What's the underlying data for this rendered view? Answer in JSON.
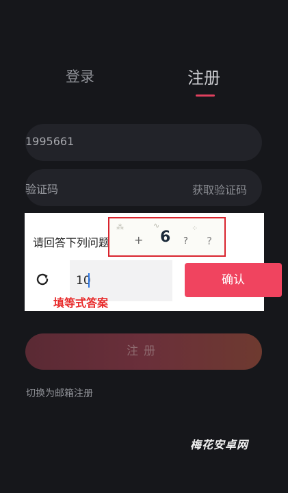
{
  "tabs": {
    "login": "登录",
    "register": "注册"
  },
  "phone_field": {
    "value": "1995661"
  },
  "code_field": {
    "placeholder": "验证码",
    "get_code_label": "获取验证码"
  },
  "captcha_dialog": {
    "question_label": "请回答下列问题",
    "captcha": {
      "operator": "+",
      "number": "6"
    },
    "answer_value": "10",
    "confirm_label": "确认",
    "hint": "填等式答案"
  },
  "register_button": "注册",
  "switch_email": "切换为邮箱注册",
  "watermark": "梅花安卓网",
  "colors": {
    "accent": "#f0445f",
    "background": "#16171b",
    "highlight_box": "#d9232d"
  }
}
